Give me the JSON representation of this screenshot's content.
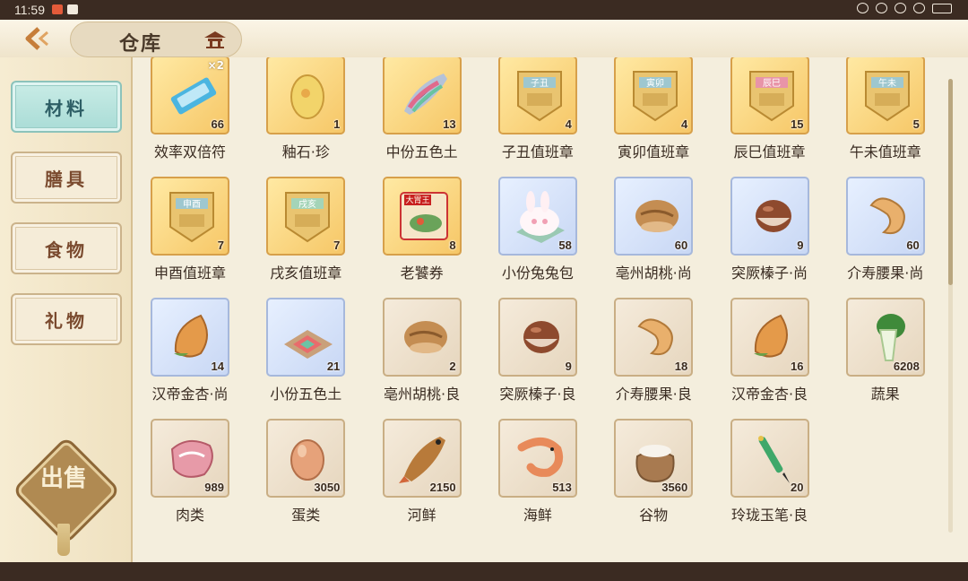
{
  "status": {
    "time": "11:59"
  },
  "header": {
    "title": "仓库"
  },
  "sidebar": {
    "tabs": [
      {
        "label": "材料",
        "active": true
      },
      {
        "label": "膳具",
        "active": false
      },
      {
        "label": "食物",
        "active": false
      },
      {
        "label": "礼物",
        "active": false
      }
    ],
    "sell_label": "出售"
  },
  "items": [
    {
      "name": "效率双倍符",
      "qty": "66",
      "style": "gold",
      "icon": "ticket-icon",
      "icon_badge": "×2"
    },
    {
      "name": "釉石·珍",
      "qty": "1",
      "style": "gold",
      "icon": "glaze-stone-icon"
    },
    {
      "name": "中份五色土",
      "qty": "13",
      "style": "gold",
      "icon": "soil-scoop-icon"
    },
    {
      "name": "子丑值班章",
      "qty": "4",
      "style": "gold",
      "icon": "badge-icon",
      "badge_text": "子丑"
    },
    {
      "name": "寅卯值班章",
      "qty": "4",
      "style": "gold",
      "icon": "badge-icon",
      "badge_text": "寅卯"
    },
    {
      "name": "辰巳值班章",
      "qty": "15",
      "style": "gold",
      "icon": "badge-pink-icon",
      "badge_text": "辰巳"
    },
    {
      "name": "午未值班章",
      "qty": "5",
      "style": "gold",
      "icon": "badge-icon",
      "badge_text": "午未"
    },
    {
      "name": "申酉值班章",
      "qty": "7",
      "style": "gold",
      "icon": "badge-icon",
      "badge_text": "申酉"
    },
    {
      "name": "戌亥值班章",
      "qty": "7",
      "style": "gold",
      "icon": "badge-green-icon",
      "badge_text": "戌亥"
    },
    {
      "name": "老饕券",
      "qty": "8",
      "style": "gold",
      "icon": "coupon-icon",
      "badge_text": "大胃王"
    },
    {
      "name": "小份兔兔包",
      "qty": "58",
      "style": "blue",
      "icon": "bunny-bun-icon"
    },
    {
      "name": "亳州胡桃·尚",
      "qty": "60",
      "style": "blue",
      "icon": "walnut-icon"
    },
    {
      "name": "突厥榛子·尚",
      "qty": "9",
      "style": "blue",
      "icon": "hazelnut-icon"
    },
    {
      "name": "介寿腰果·尚",
      "qty": "60",
      "style": "blue",
      "icon": "cashew-icon"
    },
    {
      "name": "汉帝金杏·尚",
      "qty": "14",
      "style": "blue",
      "icon": "almond-icon"
    },
    {
      "name": "小份五色土",
      "qty": "21",
      "style": "blue",
      "icon": "soil-pile-icon"
    },
    {
      "name": "亳州胡桃·良",
      "qty": "2",
      "style": "plain",
      "icon": "walnut-icon"
    },
    {
      "name": "突厥榛子·良",
      "qty": "9",
      "style": "plain",
      "icon": "hazelnut-icon"
    },
    {
      "name": "介寿腰果·良",
      "qty": "18",
      "style": "plain",
      "icon": "cashew-icon"
    },
    {
      "name": "汉帝金杏·良",
      "qty": "16",
      "style": "plain",
      "icon": "almond-icon"
    },
    {
      "name": "蔬果",
      "qty": "6208",
      "style": "plain",
      "icon": "bok-choy-icon"
    },
    {
      "name": "肉类",
      "qty": "989",
      "style": "plain",
      "icon": "meat-icon"
    },
    {
      "name": "蛋类",
      "qty": "3050",
      "style": "plain",
      "icon": "egg-icon"
    },
    {
      "name": "河鲜",
      "qty": "2150",
      "style": "plain",
      "icon": "fish-icon"
    },
    {
      "name": "海鲜",
      "qty": "513",
      "style": "plain",
      "icon": "shrimp-icon"
    },
    {
      "name": "谷物",
      "qty": "3560",
      "style": "plain",
      "icon": "grain-sack-icon"
    },
    {
      "name": "玲珑玉笔·良",
      "qty": "20",
      "style": "plain",
      "icon": "jade-brush-icon"
    }
  ]
}
